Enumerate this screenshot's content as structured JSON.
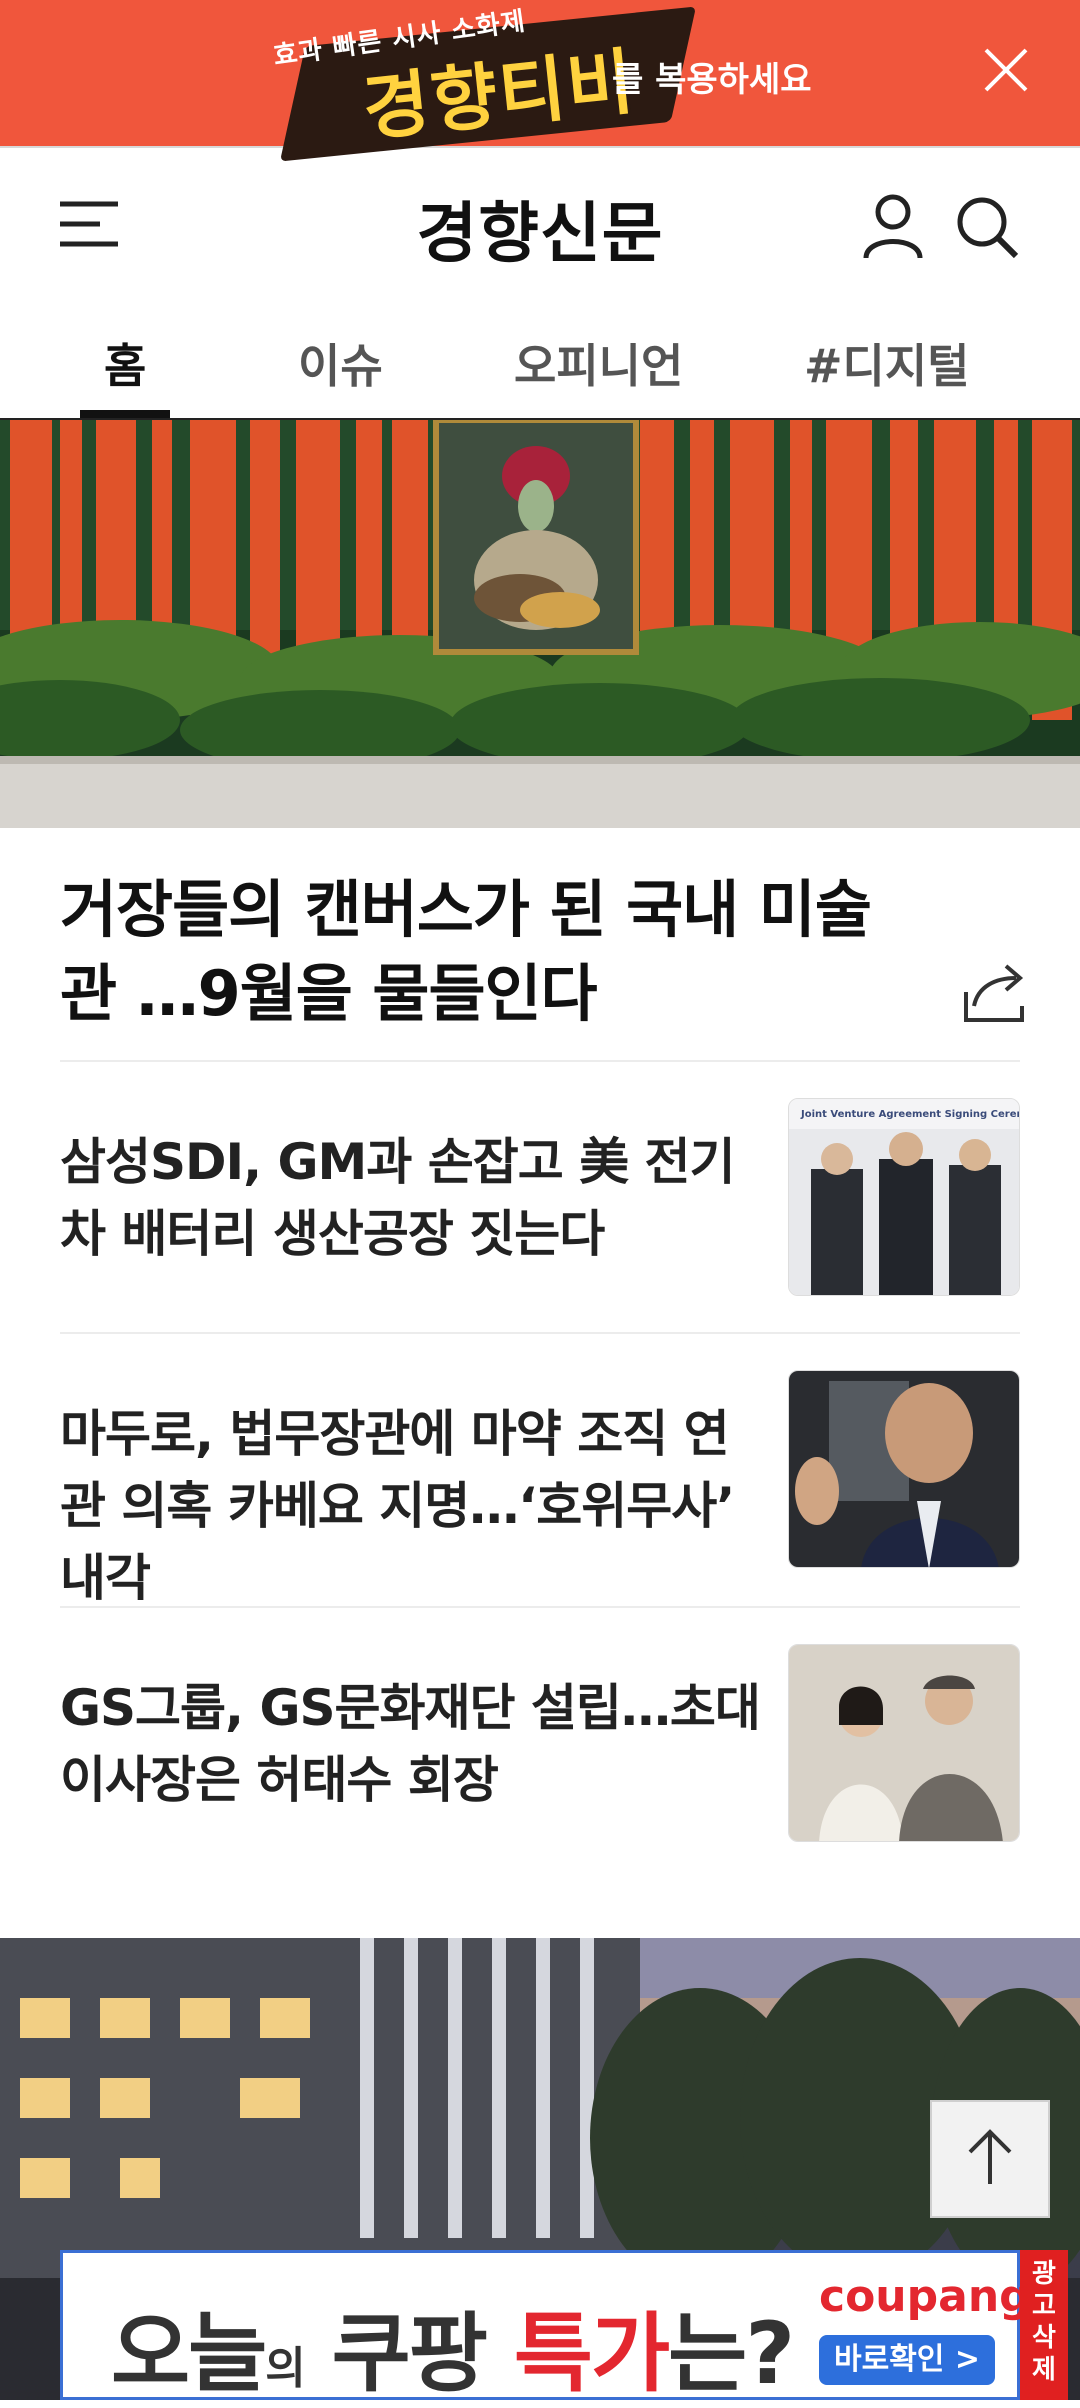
{
  "top_banner": {
    "small_text": "효과 빠른 시사 소화제",
    "big_text": "경향티비",
    "tail_text": "를 복용하세요",
    "bg_color": "#f0563c"
  },
  "header": {
    "logo": "경향신문",
    "icons": [
      "menu-icon",
      "user-icon",
      "search-icon"
    ]
  },
  "tabs": [
    {
      "label": "홈",
      "active": true
    },
    {
      "label": "이슈",
      "active": false
    },
    {
      "label": "오피니언",
      "active": false
    },
    {
      "label": "#디지털",
      "active": false
    }
  ],
  "hero": {
    "title": "거장들의 캔버스가 된 국내 미술관 …9월을 물들인다"
  },
  "news": [
    {
      "title": "삼성SDI, GM과 손잡고 美 전기차 배터리 생산공장 짓는다",
      "thumb_caption": "Joint Venture Agreement Signing Ceremony"
    },
    {
      "title": "마두로, 법무장관에 마약 조직 연관 의혹 카베요 지명…‘호위무사’ 내각"
    },
    {
      "title": "GS그룹, GS문화재단 설립…초대 이사장은 허태수 회장"
    }
  ],
  "bottom_ad": {
    "text_pre": "오늘",
    "text_small": "의",
    "text_mid": " 쿠팡 ",
    "text_highlight": "특가",
    "text_post": "는?",
    "brand": "coupang",
    "cta": "바로확인 >",
    "remove_label": "광고삭제",
    "highlight_color": "#e3272f"
  }
}
